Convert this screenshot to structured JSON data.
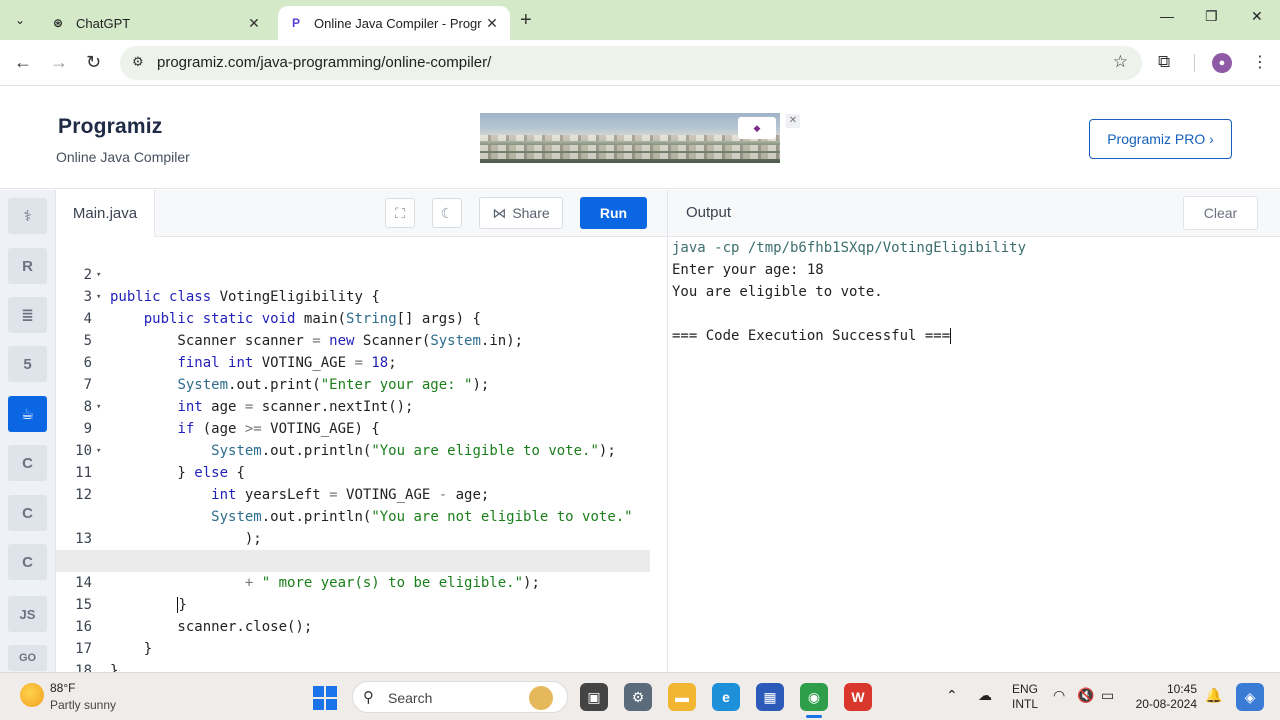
{
  "browser": {
    "tabs": [
      {
        "title": "ChatGPT",
        "icon": "chatgpt-icon"
      },
      {
        "title": "Online Java Compiler - Program",
        "icon": "programiz-icon"
      }
    ],
    "url": "programiz.com/java-programming/online-compiler/"
  },
  "site": {
    "logo": "Programiz",
    "subtitle": "Online Java Compiler",
    "pro_button": "Programiz PRO ›"
  },
  "rail": {
    "items": [
      {
        "icon": "python-icon",
        "label": ""
      },
      {
        "icon": "r-icon",
        "label": "R"
      },
      {
        "icon": "database-icon",
        "label": ""
      },
      {
        "icon": "html5-icon",
        "label": "5"
      },
      {
        "icon": "java-icon",
        "label": "☕"
      },
      {
        "icon": "c-icon",
        "label": "C"
      },
      {
        "icon": "cpp-icon",
        "label": "C"
      },
      {
        "icon": "csharp-icon",
        "label": "C"
      },
      {
        "icon": "js-icon",
        "label": "JS"
      },
      {
        "icon": "go-icon",
        "label": "GO"
      }
    ]
  },
  "editor": {
    "filename": "Main.java",
    "share_label": "Share",
    "run_label": "Run",
    "line_numbers": [
      "2",
      "3",
      "4",
      "5",
      "6",
      "7",
      "8",
      "9",
      "10",
      "11",
      "12",
      "",
      "13",
      "",
      "14",
      "15",
      "16",
      "17",
      "18"
    ]
  },
  "output": {
    "title": "Output",
    "clear_label": "Clear",
    "lines": [
      "java -cp /tmp/b6fhb1SXqp/VotingEligibility",
      "Enter your age: 18",
      "You are eligible to vote.",
      "",
      "=== Code Execution Successful ==="
    ]
  },
  "taskbar": {
    "weather_temp": "88°F",
    "weather_desc": "Partly sunny",
    "search_label": "Search",
    "lang_top": "ENG",
    "lang_bottom": "INTL",
    "time": "10:45",
    "date": "20-08-2024"
  },
  "colors": {
    "accent": "#0b66e4",
    "tabbar": "#d3e9c8",
    "keyword": "#2222bb",
    "string": "#1a7f1a"
  }
}
